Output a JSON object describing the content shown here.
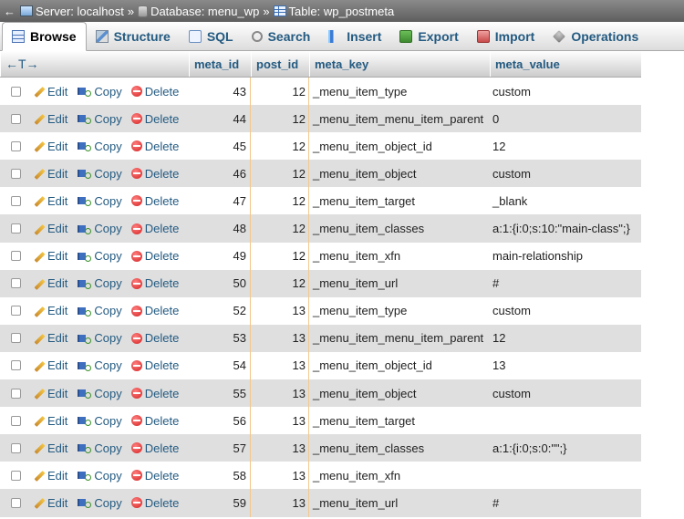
{
  "breadcrumb": {
    "back": "←",
    "server": "Server: localhost",
    "database": "Database: menu_wp",
    "table": "Table: wp_postmeta",
    "sep": "»"
  },
  "tabs": [
    {
      "label": "Browse",
      "icon": "browse-icon",
      "active": true
    },
    {
      "label": "Structure",
      "icon": "structure-icon"
    },
    {
      "label": "SQL",
      "icon": "sql-icon"
    },
    {
      "label": "Search",
      "icon": "search-icon"
    },
    {
      "label": "Insert",
      "icon": "insert-icon"
    },
    {
      "label": "Export",
      "icon": "export-icon"
    },
    {
      "label": "Import",
      "icon": "import-icon"
    },
    {
      "label": "Operations",
      "icon": "operations-icon"
    }
  ],
  "table": {
    "arrows": "←T→",
    "columns": [
      "meta_id",
      "post_id",
      "meta_key",
      "meta_value"
    ],
    "action_labels": {
      "edit": "Edit",
      "copy": "Copy",
      "delete": "Delete"
    },
    "rows": [
      {
        "meta_id": "43",
        "post_id": "12",
        "meta_key": "_menu_item_type",
        "meta_value": "custom"
      },
      {
        "meta_id": "44",
        "post_id": "12",
        "meta_key": "_menu_item_menu_item_parent",
        "meta_value": "0"
      },
      {
        "meta_id": "45",
        "post_id": "12",
        "meta_key": "_menu_item_object_id",
        "meta_value": "12"
      },
      {
        "meta_id": "46",
        "post_id": "12",
        "meta_key": "_menu_item_object",
        "meta_value": "custom"
      },
      {
        "meta_id": "47",
        "post_id": "12",
        "meta_key": "_menu_item_target",
        "meta_value": "_blank"
      },
      {
        "meta_id": "48",
        "post_id": "12",
        "meta_key": "_menu_item_classes",
        "meta_value": "a:1:{i:0;s:10:\"main-class\";}"
      },
      {
        "meta_id": "49",
        "post_id": "12",
        "meta_key": "_menu_item_xfn",
        "meta_value": "main-relationship"
      },
      {
        "meta_id": "50",
        "post_id": "12",
        "meta_key": "_menu_item_url",
        "meta_value": "#"
      },
      {
        "meta_id": "52",
        "post_id": "13",
        "meta_key": "_menu_item_type",
        "meta_value": "custom"
      },
      {
        "meta_id": "53",
        "post_id": "13",
        "meta_key": "_menu_item_menu_item_parent",
        "meta_value": "12"
      },
      {
        "meta_id": "54",
        "post_id": "13",
        "meta_key": "_menu_item_object_id",
        "meta_value": "13"
      },
      {
        "meta_id": "55",
        "post_id": "13",
        "meta_key": "_menu_item_object",
        "meta_value": "custom"
      },
      {
        "meta_id": "56",
        "post_id": "13",
        "meta_key": "_menu_item_target",
        "meta_value": ""
      },
      {
        "meta_id": "57",
        "post_id": "13",
        "meta_key": "_menu_item_classes",
        "meta_value": "a:1:{i:0;s:0:\"\";}"
      },
      {
        "meta_id": "58",
        "post_id": "13",
        "meta_key": "_menu_item_xfn",
        "meta_value": ""
      },
      {
        "meta_id": "59",
        "post_id": "13",
        "meta_key": "_menu_item_url",
        "meta_value": "#"
      }
    ]
  }
}
